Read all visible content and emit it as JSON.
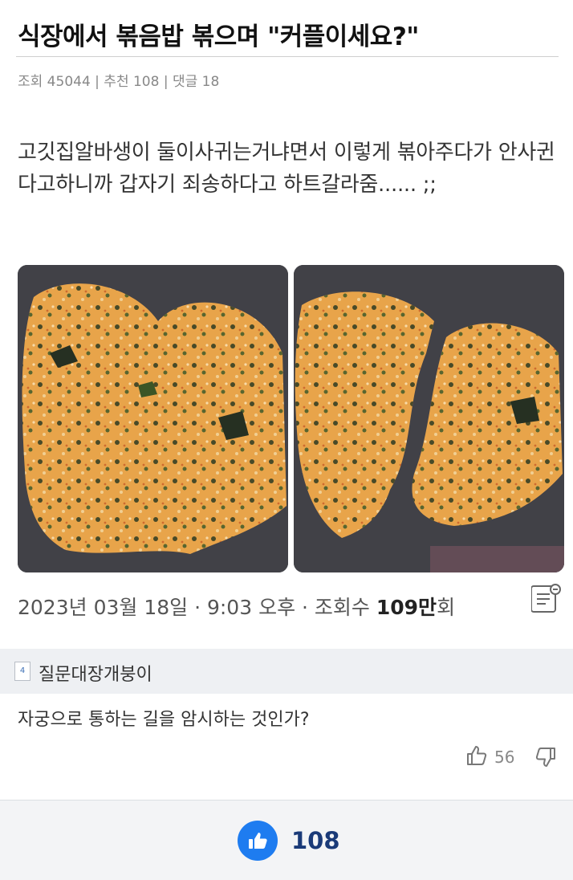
{
  "post": {
    "title": "식장에서 볶음밥 볶으며 \"커플이세요?\"",
    "meta": "조회 45044 | 추천 108 | 댓글 18",
    "body": "고깃집알바생이 둘이사귀는거냐면서 이렇게 볶아주다가 안사귄다고하니까 갑자기 죄송하다고 하트갈라줌...... ;;"
  },
  "embedded": {
    "date_prefix": "2023년 03월 18일 · 9:03 오후 · 조회수 ",
    "views_num": "109",
    "views_unit": "만",
    "views_suffix": "회"
  },
  "comment": {
    "flag_text": "4",
    "nickname": "질문대장개붕이",
    "text": "자궁으로 통하는 길을 암시하는 것인가?",
    "likes": "56"
  },
  "recommend": {
    "count": "108"
  },
  "colors": {
    "accent": "#1e7cf0",
    "rice": "#e8a44a",
    "pan": "#3c3d42"
  },
  "icons": [
    "memo-icon",
    "thumb-up-icon",
    "thumb-down-icon",
    "like-icon"
  ]
}
